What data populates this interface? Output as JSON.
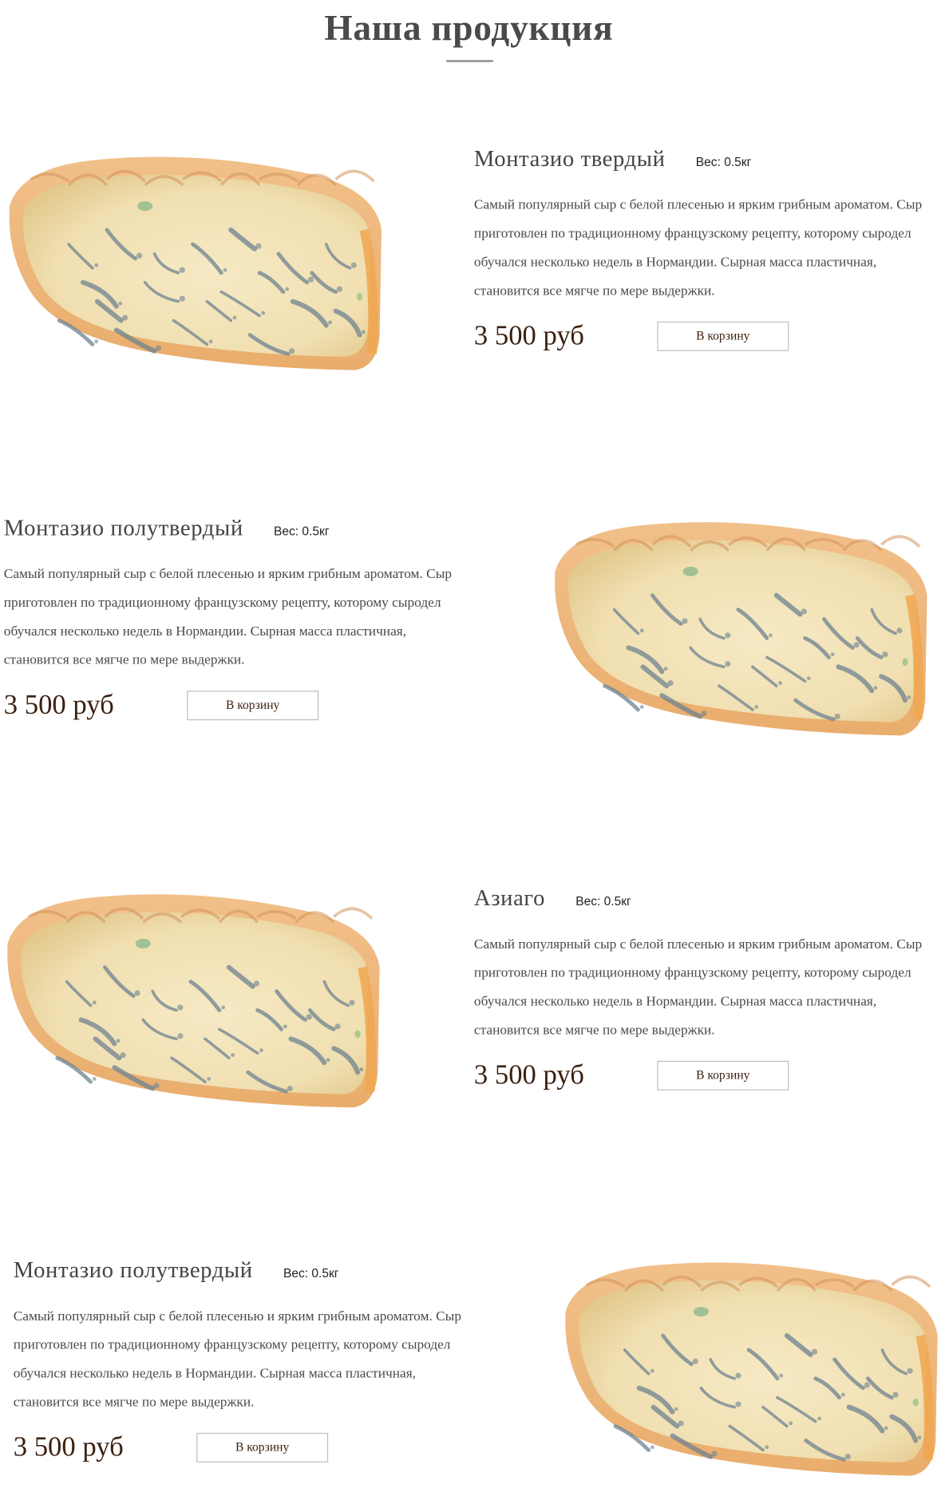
{
  "section": {
    "title": "Наша продукция"
  },
  "products": [
    {
      "name": "Монтазио твердый",
      "weight": "Вес: 0.5кг",
      "description": "Самый популярный сыр с белой плесенью и ярким грибным ароматом. Сыр приготовлен по традиционному французскому рецепту, которому сыродел обучался несколько недель в Нормандии. Сырная масса пластичная, становится все мягче по мере выдержки.",
      "price": "3 500 руб",
      "cart_label": "В корзину",
      "image_icon": "blue-cheese-wedge"
    },
    {
      "name": "Монтазио полутвердый",
      "weight": "Вес: 0.5кг",
      "description": "Самый популярный сыр с белой плесенью и ярким грибным ароматом. Сыр приготовлен по традиционному французскому рецепту, которому сыродел обучался несколько недель в Нормандии. Сырная масса пластичная, становится все мягче по мере выдержки.",
      "price": "3 500 руб",
      "cart_label": "В корзину",
      "image_icon": "blue-cheese-wedge"
    },
    {
      "name": "Азиаго",
      "weight": "Вес: 0.5кг",
      "description": "Самый популярный сыр с белой плесенью и ярким грибным ароматом. Сыр приготовлен по традиционному французскому рецепту, которому сыродел обучался несколько недель в Нормандии. Сырная масса пластичная, становится все мягче по мере выдержки.",
      "price": "3 500 руб",
      "cart_label": "В корзину",
      "image_icon": "blue-cheese-wedge"
    },
    {
      "name": "Монтазио полутвердый",
      "weight": "Вес: 0.5кг",
      "description": "Самый популярный сыр с белой плесенью и ярким грибным ароматом. Сыр приготовлен по традиционному французскому рецепту, которому сыродел обучался несколько недель в Нормандии. Сырная масса пластичная, становится все мягче по мере выдержки.",
      "price": "3 500 руб",
      "cart_label": "В корзину",
      "image_icon": "blue-cheese-wedge"
    }
  ],
  "colors": {
    "price": "#3b1f0f",
    "title": "#4a4a4a",
    "rind": "#e9ad6c",
    "paste": "#f0dfb1",
    "mold": "#6d8290"
  }
}
